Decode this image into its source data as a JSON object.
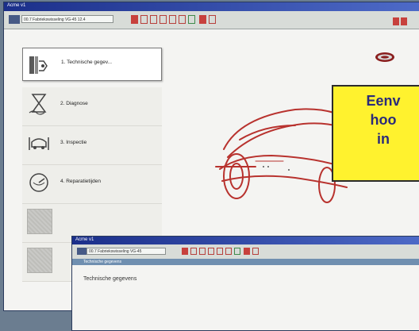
{
  "main_window": {
    "title": "Acme v1",
    "toolbar_combo": "00.7  Fabriekswisseling  VG-45  12.4"
  },
  "menu": {
    "items": [
      {
        "label": "1. Technische gegev..."
      },
      {
        "label": "2. Diagnose"
      },
      {
        "label": "3. Inspectie"
      },
      {
        "label": "4. Reparatietijden"
      },
      {
        "label": ""
      },
      {
        "label": ""
      }
    ]
  },
  "callout": {
    "line1": "Eenv",
    "line2": "hoo",
    "line3": "in"
  },
  "inner_window": {
    "title": "Acme v1",
    "toolbar_combo": "00.7  Fabriekswisseling  VG-45",
    "breadcrumb": "Technische gegevens",
    "page_title": "Technische gegevens"
  },
  "colors": {
    "accent_red": "#c7413d",
    "callout_yellow": "#fff22e",
    "titlebar_blue": "#1b2f8a"
  }
}
